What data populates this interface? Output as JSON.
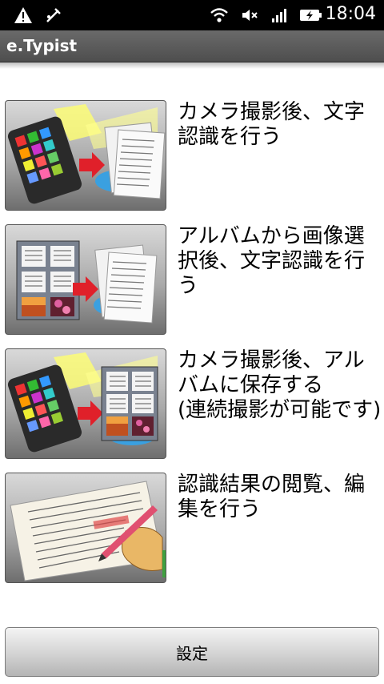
{
  "status_bar": {
    "time": "18:04",
    "icons": [
      "warning-icon",
      "usb-debug-icon",
      "wifi-icon",
      "mute-icon",
      "signal-icon",
      "battery-charging-icon"
    ]
  },
  "app": {
    "title": "e.Typist"
  },
  "menu": [
    {
      "label": "カメラ撮影後、文字\n認識を行う",
      "icon": "camera-to-document-icon"
    },
    {
      "label": "アルバムから画像選\n択後、文字認識を行\nう",
      "icon": "album-to-document-icon"
    },
    {
      "label": "カメラ撮影後、アル\nバムに保存する\n(連続撮影が可能です)",
      "icon": "camera-to-album-icon"
    },
    {
      "label": "認識結果の閲覧、編\n集を行う",
      "icon": "document-edit-icon"
    }
  ],
  "settings": {
    "label": "設定"
  },
  "colors": {
    "accent_red": "#e0202a",
    "title_bar": "#5a5a5a"
  }
}
